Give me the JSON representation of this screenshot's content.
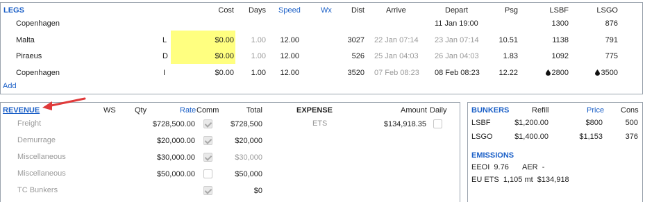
{
  "legs": {
    "title": "LEGS",
    "headers": {
      "cost": "Cost",
      "days": "Days",
      "speed": "Speed",
      "wx": "Wx",
      "dist": "Dist",
      "arrive": "Arrive",
      "depart": "Depart",
      "psg": "Psg",
      "lsbf": "LSBF",
      "lsgo": "LSGO"
    },
    "rows": [
      {
        "port": "Copenhagen",
        "type": "",
        "cost": "",
        "days": "",
        "speed": "",
        "dist": "",
        "arrive": "",
        "depart": "11 Jan 19:00",
        "psg": "",
        "lsbf": "1300",
        "lsgo": "876"
      },
      {
        "port": "Malta",
        "type": "L",
        "cost": "$0.00",
        "days": "1.00",
        "speed": "12.00",
        "dist": "3027",
        "arrive": "22 Jan 07:14",
        "depart": "23 Jan 07:14",
        "psg": "10.51",
        "lsbf": "1138",
        "lsgo": "791"
      },
      {
        "port": "Piraeus",
        "type": "D",
        "cost": "$0.00",
        "days": "1.00",
        "speed": "12.00",
        "dist": "526",
        "arrive": "25 Jan 04:03",
        "depart": "26 Jan 04:03",
        "psg": "1.83",
        "lsbf": "1092",
        "lsgo": "775"
      },
      {
        "port": "Copenhagen",
        "type": "I",
        "cost": "$0.00",
        "days": "1.00",
        "speed": "12.00",
        "dist": "3520",
        "arrive": "07 Feb 08:23",
        "depart": "08 Feb 08:23",
        "psg": "12.22",
        "lsbf": "2800",
        "lsgo": "3500"
      }
    ],
    "add_label": "Add"
  },
  "revenue": {
    "title": "REVENUE",
    "headers": {
      "ws": "WS",
      "qty": "Qty",
      "rate": "Rate",
      "comm": "Comm",
      "total": "Total"
    },
    "rows": [
      {
        "label": "Freight",
        "rate": "$728,500.00",
        "comm_checked": true,
        "total": "$728,500"
      },
      {
        "label": "Demurrage",
        "rate": "$20,000.00",
        "comm_checked": true,
        "total": "$20,000"
      },
      {
        "label": "Miscellaneous",
        "rate": "$30,000.00",
        "comm_checked": true,
        "total": "$30,000"
      },
      {
        "label": "Miscellaneous",
        "rate": "$50,000.00",
        "comm_checked": false,
        "total": "$50,000"
      },
      {
        "label": "TC Bunkers",
        "rate": "",
        "comm_checked": true,
        "total": "$0"
      }
    ]
  },
  "expense": {
    "title": "EXPENSE",
    "headers": {
      "amount": "Amount",
      "daily": "Daily"
    },
    "rows": [
      {
        "label": "ETS",
        "amount": "$134,918.35",
        "daily_checked": false
      }
    ]
  },
  "bunkers": {
    "title": "BUNKERS",
    "headers": {
      "refill": "Refill",
      "price": "Price",
      "cons": "Cons"
    },
    "rows": [
      {
        "fuel": "LSBF",
        "refill": "$1,200.00",
        "price": "$800",
        "cons": "500"
      },
      {
        "fuel": "LSGO",
        "refill": "$1,400.00",
        "price": "$1,153",
        "cons": "376"
      }
    ]
  },
  "emissions": {
    "title": "EMISSIONS",
    "eeoi_label": "EEOI",
    "eeoi_value": "9.76",
    "aer_label": "AER",
    "aer_value": "-",
    "euets_label": "EU ETS",
    "euets_value": "1,105 mt",
    "euets_amount": "$134,918"
  },
  "colors": {
    "accent": "#1a5fc7",
    "highlight": "#ffff80",
    "arrow": "#e03a3a"
  }
}
